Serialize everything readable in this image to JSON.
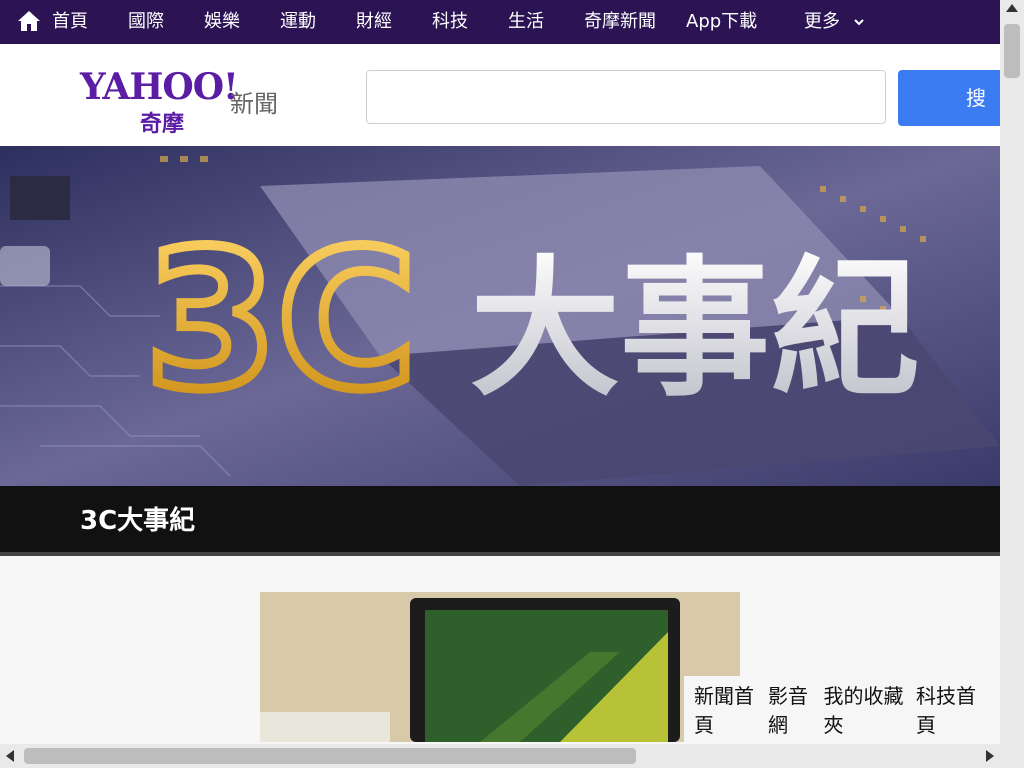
{
  "nav": {
    "items": [
      {
        "label": "首頁"
      },
      {
        "label": "國際"
      },
      {
        "label": "娛樂"
      },
      {
        "label": "運動"
      },
      {
        "label": "財經"
      },
      {
        "label": "科技"
      },
      {
        "label": "生活"
      },
      {
        "label": "奇摩新聞"
      },
      {
        "label": "App下載"
      },
      {
        "label": "更多"
      }
    ]
  },
  "header": {
    "logo_main": "YAHOO!",
    "logo_sub": "奇摩",
    "logo_news": "新聞",
    "search_value": "",
    "search_button": "搜尋"
  },
  "banner": {
    "graphic_text_3c": "3C",
    "graphic_text_title": "大事紀",
    "section_title": "3C大事紀"
  },
  "floating_bar": {
    "items": [
      "新聞首頁",
      "影音網",
      "我的收藏夾",
      "科技首頁"
    ]
  },
  "colors": {
    "nav_bg": "#2c1454",
    "brand_purple": "#5b1da3",
    "search_button": "#3b7cf3"
  },
  "icons": {
    "home": "home-icon",
    "more": "chevron-down-icon"
  }
}
